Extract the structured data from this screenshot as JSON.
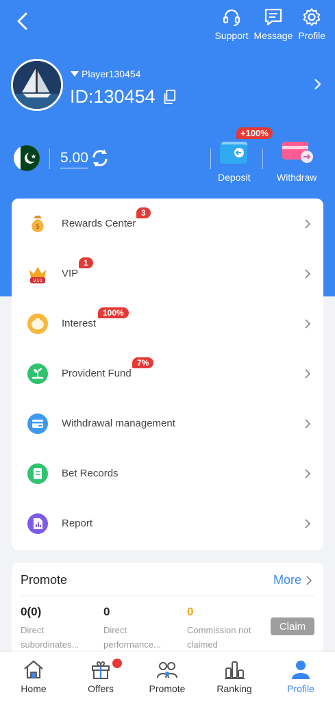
{
  "header": {
    "actions": [
      {
        "label": "Support",
        "icon": "headset-icon"
      },
      {
        "label": "Message",
        "icon": "message-icon"
      },
      {
        "label": "Profile",
        "icon": "gear-icon"
      }
    ]
  },
  "user": {
    "name": "Player130454",
    "id": "ID:130454"
  },
  "wallet": {
    "balance": "5.00",
    "deposit_label": "Deposit",
    "deposit_badge": "+100%",
    "withdraw_label": "Withdraw"
  },
  "menu": [
    {
      "label": "Rewards Center",
      "badge": "3",
      "icon": "money-bag-icon"
    },
    {
      "label": "VIP",
      "badge": "1",
      "icon": "vip-crown-icon"
    },
    {
      "label": "Interest",
      "badge": "100%",
      "icon": "piggy-bank-icon"
    },
    {
      "label": "Provident Fund",
      "badge": "7%",
      "icon": "fund-plant-icon"
    },
    {
      "label": "Withdrawal management",
      "badge": "",
      "icon": "card-icon"
    },
    {
      "label": "Bet Records",
      "badge": "",
      "icon": "records-icon"
    },
    {
      "label": "Report",
      "badge": "",
      "icon": "report-icon"
    }
  ],
  "promote": {
    "title": "Promote",
    "more_label": "More",
    "stats": [
      {
        "value": "0(0)",
        "label": "Direct subordinates..."
      },
      {
        "value": "0",
        "label": "Direct performance..."
      },
      {
        "value": "0",
        "label": "Commission not claimed"
      }
    ],
    "claim_label": "Claim"
  },
  "bottom_nav": [
    {
      "label": "Home",
      "icon": "home-icon"
    },
    {
      "label": "Offers",
      "icon": "gift-icon"
    },
    {
      "label": "Promote",
      "icon": "people-icon"
    },
    {
      "label": "Ranking",
      "icon": "ranking-icon"
    },
    {
      "label": "Profile",
      "icon": "profile-icon"
    }
  ],
  "colors": {
    "primary": "#3a86f3",
    "badge": "#e53935",
    "commission": "#f5a623"
  }
}
